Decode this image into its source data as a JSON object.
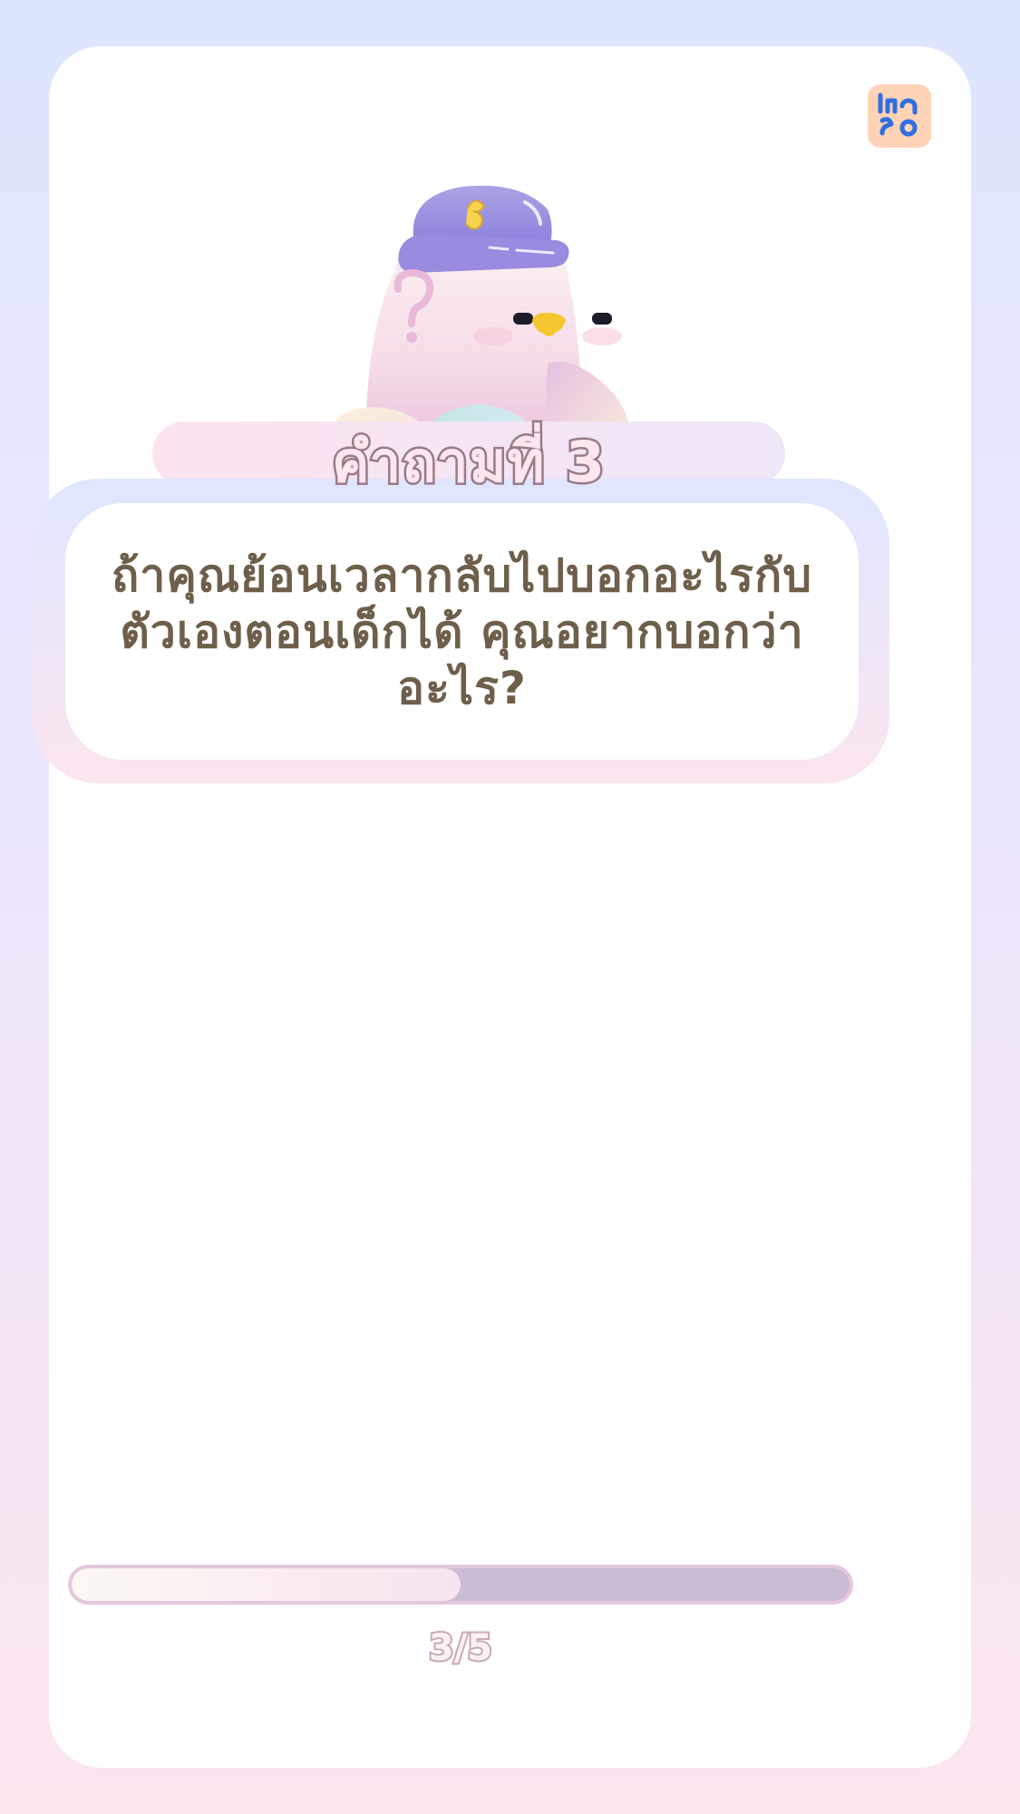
{
  "app": {
    "logo_icon": "thai-letters-logo-icon",
    "mascot_icon": "bird-mascot-with-cap-icon"
  },
  "question": {
    "title": "คำถามที่ 3",
    "text": "ถ้าคุณย้อนเวลากลับไปบอกอะไรกับตัวเองตอนเด็กได้ คุณอยากบอกว่าอะไร?"
  },
  "progress": {
    "current": 3,
    "total": 5,
    "label": "3/5",
    "fraction": 0.5
  },
  "colors": {
    "text_brown": "#6e5f4b",
    "title_stroke": "#9a7a86",
    "progress_track": "#c9bcd3",
    "logo_bg": "#ffd3b6",
    "logo_glyph": "#2f6fe0"
  }
}
